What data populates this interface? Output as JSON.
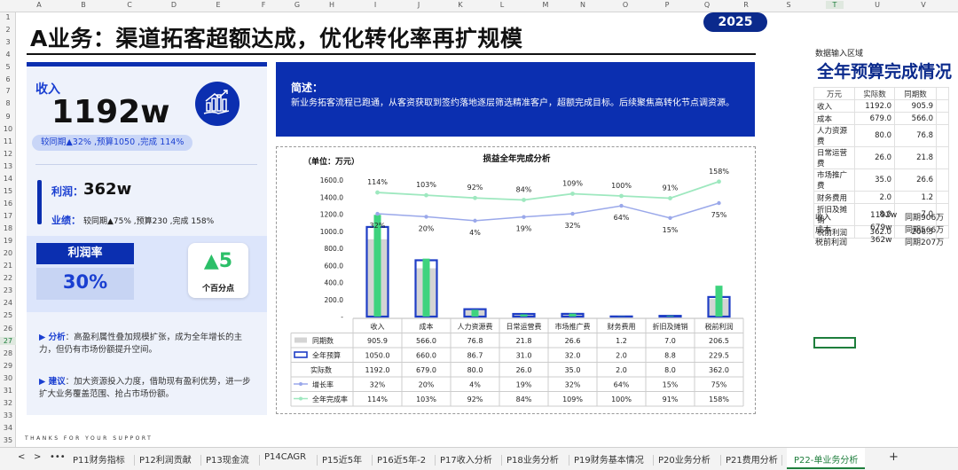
{
  "columns": [
    "A",
    "B",
    "C",
    "D",
    "E",
    "F",
    "G",
    "H",
    "I",
    "J",
    "K",
    "L",
    "M",
    "N",
    "O",
    "P",
    "Q",
    "R",
    "S",
    "T",
    "U",
    "V"
  ],
  "rows": [
    "1",
    "2",
    "3",
    "4",
    "5",
    "6",
    "7",
    "8",
    "9",
    "10",
    "11",
    "12",
    "13",
    "14",
    "15",
    "16",
    "17",
    "18",
    "19",
    "20",
    "21",
    "22",
    "23",
    "24",
    "25",
    "26",
    "27",
    "28",
    "29",
    "30",
    "31",
    "32",
    "33",
    "34",
    "35"
  ],
  "dashboard": {
    "title": "A业务：渠道拓客超额达成，优化转化率再扩规模",
    "year": "2025",
    "revenue_label": "收入",
    "revenue_value": "1192w",
    "revenue_sub": "较同期▲32% ,预算1050 ,完成 114%",
    "profit_label": "利润：",
    "profit_value": "362w",
    "perf_label": "业绩：",
    "perf_text": "较同期▲75% ,预算230 ,完成 158%",
    "rate_title": "利润率",
    "rate_value": "30%",
    "pts_value": "▲5",
    "pts_label": "个百分点",
    "analysis_label": "▶ 分析",
    "analysis_text": "：高盈利属性叠加规模扩张，成为全年增长的主力，但仍有市场份额提升空间。",
    "advice_label": "▶ 建议",
    "advice_text": "：加大资源投入力度，借助现有盈利优势，进一步扩大业务覆盖范围、抢占市场份额。",
    "summary_title": "简述：",
    "summary_text": "新业务拓客流程已跑通，从客资获取到签约落地逐层筛选精准客户，超额完成目标。后续聚焦高转化节点调资源。",
    "bottom_note": "THANKS FOR YOUR SUPPORT"
  },
  "chart_data": {
    "type": "bar",
    "title": "损益全年完成分析",
    "unit_label": "（单位：万元）",
    "categories": [
      "收入",
      "成本",
      "人力资源费",
      "日常运营费",
      "市场推广费",
      "财务费用",
      "折旧及摊销",
      "税前利润"
    ],
    "ylim": [
      0,
      1600
    ],
    "yticks": [
      "1600.0",
      "1400.0",
      "1200.0",
      "1000.0",
      "800.0",
      "600.0",
      "400.0",
      "200.0",
      "-"
    ],
    "series": [
      {
        "name": "同期数",
        "values": [
          905.9,
          566.0,
          76.8,
          21.8,
          26.6,
          1.2,
          7.0,
          206.5
        ],
        "color": "#d4d4d4"
      },
      {
        "name": "全年预算",
        "values": [
          1050.0,
          660.0,
          86.7,
          31.0,
          32.0,
          2.0,
          8.8,
          229.5
        ],
        "color": "#1f3ec6"
      },
      {
        "name": "实际数",
        "values": [
          1192.0,
          679.0,
          80.0,
          26.0,
          35.0,
          2.0,
          8.0,
          362.0
        ],
        "color": "#3ed37e"
      }
    ],
    "growth": {
      "name": "增长率",
      "labels": [
        "32%",
        "20%",
        "4%",
        "19%",
        "32%",
        "64%",
        "15%",
        "75%"
      ],
      "values": [
        32,
        20,
        4,
        19,
        32,
        64,
        15,
        75
      ],
      "color": "#9aa8ea"
    },
    "completion": {
      "name": "全年完成率",
      "labels": [
        "114%",
        "103%",
        "92%",
        "84%",
        "109%",
        "100%",
        "91%",
        "158%"
      ],
      "values": [
        114,
        103,
        92,
        84,
        109,
        100,
        91,
        158
      ],
      "color": "#9ee8bf"
    },
    "table_rows": [
      {
        "name": "同期数",
        "cells": [
          "905.9",
          "566.0",
          "76.8",
          "21.8",
          "26.6",
          "1.2",
          "7.0",
          "206.5"
        ]
      },
      {
        "name": "全年预算",
        "cells": [
          "1050.0",
          "660.0",
          "86.7",
          "31.0",
          "32.0",
          "2.0",
          "8.8",
          "229.5"
        ]
      },
      {
        "name": "实际数",
        "cells": [
          "1192.0",
          "679.0",
          "80.0",
          "26.0",
          "35.0",
          "2.0",
          "8.0",
          "362.0"
        ]
      },
      {
        "name": "增长率",
        "cells": [
          "32%",
          "20%",
          "4%",
          "19%",
          "32%",
          "64%",
          "15%",
          "75%"
        ]
      },
      {
        "name": "全年完成率",
        "cells": [
          "114%",
          "103%",
          "92%",
          "84%",
          "109%",
          "100%",
          "91%",
          "158%"
        ]
      }
    ]
  },
  "right_area": {
    "input_label": "数据输入区域",
    "title": "全年预算完成情况",
    "headers": [
      "万元",
      "实际数",
      "同期数"
    ],
    "rows": [
      [
        "收入",
        "1192.0",
        "905.9"
      ],
      [
        "成本",
        "679.0",
        "566.0"
      ],
      [
        "人力资源费",
        "80.0",
        "76.8"
      ],
      [
        "日常运营费",
        "26.0",
        "21.8"
      ],
      [
        "市场推广费",
        "35.0",
        "26.6"
      ],
      [
        "财务费用",
        "2.0",
        "1.2"
      ],
      [
        "折旧及摊销",
        "8.0",
        "7.0"
      ],
      [
        "税前利润",
        "362.0",
        "206.5"
      ]
    ],
    "summary": [
      [
        "收入",
        "1192w",
        "同期906万"
      ],
      [
        "成本",
        "679w",
        "同期566万"
      ],
      [
        "税前利润",
        "362w",
        "同期207万"
      ]
    ]
  },
  "tabs": [
    "P11财务指标",
    "P12利润贡献",
    "P13现金流",
    "P14CAGR",
    "P15近5年",
    "P16近5年-2",
    "P17收入分析",
    "P18业务分析",
    "P19财务基本情况",
    "P20业务分析",
    "P21费用分析",
    "P22-单业务分析"
  ],
  "tab_more": "•••",
  "tab_add": "+",
  "nav_prev": "<",
  "nav_next": ">",
  "colors": {
    "brand": "#0b2fb0",
    "accent_green": "#3ed37e",
    "dark_blue": "#0b2a8c"
  }
}
